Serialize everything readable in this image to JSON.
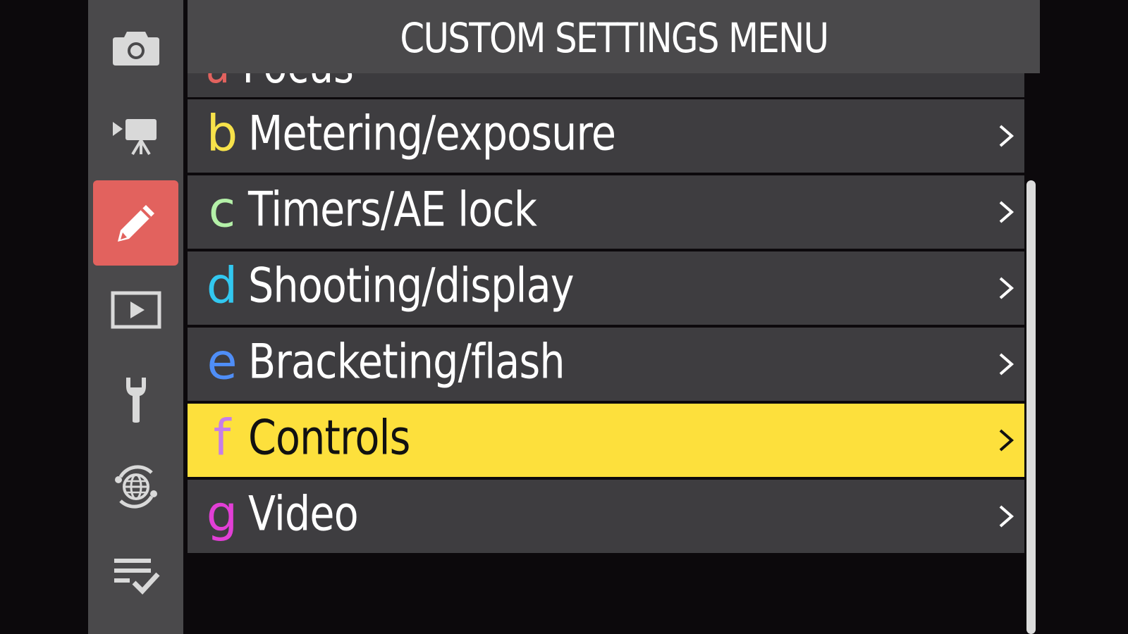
{
  "header": {
    "title": "CUSTOM SETTINGS MENU"
  },
  "rail": {
    "items": [
      {
        "icon": "camera-icon",
        "active": false
      },
      {
        "icon": "video-camera-icon",
        "active": false
      },
      {
        "icon": "pencil-icon",
        "active": true
      },
      {
        "icon": "playback-icon",
        "active": false
      },
      {
        "icon": "wrench-icon",
        "active": false
      },
      {
        "icon": "network-icon",
        "active": false
      },
      {
        "icon": "my-menu-icon",
        "active": false
      }
    ],
    "active_color": "#e2625e"
  },
  "menu": {
    "partial_item": {
      "letter": "a",
      "label": "Focus"
    },
    "items": [
      {
        "letter": "b",
        "label": "Metering/exposure",
        "letter_color": "#f7e24a",
        "selected": false
      },
      {
        "letter": "c",
        "label": "Timers/AE lock",
        "letter_color": "#b4f0a8",
        "selected": false
      },
      {
        "letter": "d",
        "label": "Shooting/display",
        "letter_color": "#32c8f0",
        "selected": false
      },
      {
        "letter": "e",
        "label": "Bracketing/flash",
        "letter_color": "#4f8ef7",
        "selected": false
      },
      {
        "letter": "f",
        "label": "Controls",
        "letter_color": "#c67ee8",
        "selected": true
      },
      {
        "letter": "g",
        "label": "Video",
        "letter_color": "#e23fd6",
        "selected": false
      }
    ],
    "selected_color": "#fde03c"
  }
}
